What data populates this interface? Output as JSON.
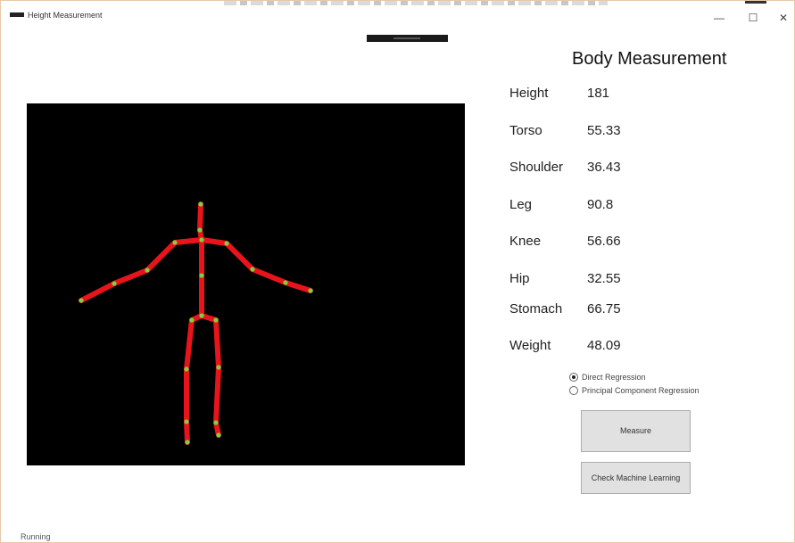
{
  "window": {
    "title": "Height Measurement",
    "minimize_glyph": "—",
    "maximize_glyph": "☐",
    "close_glyph": "✕"
  },
  "panel": {
    "title": "Body Measurement",
    "measurements": [
      {
        "label": "Height",
        "value": "181"
      },
      {
        "label": "Torso",
        "value": "55.33"
      },
      {
        "label": "Shoulder",
        "value": "36.43"
      },
      {
        "label": "Leg",
        "value": "90.8"
      },
      {
        "label": "Knee",
        "value": "56.66"
      },
      {
        "label": "Hip",
        "value": "32.55"
      },
      {
        "label": "Stomach",
        "value": "66.75"
      },
      {
        "label": "Weight",
        "value": "48.09"
      }
    ],
    "regression_options": [
      {
        "label": "Direct Regression",
        "selected": true
      },
      {
        "label": "Principal Component Regression",
        "selected": false
      }
    ],
    "measure_button": "Measure",
    "ml_button": "Check Machine Learning"
  },
  "skeleton": {
    "bone_color": "#e8141c",
    "joint_color": "#7fd13b",
    "background": "#000000"
  },
  "status": {
    "text": "Running"
  }
}
